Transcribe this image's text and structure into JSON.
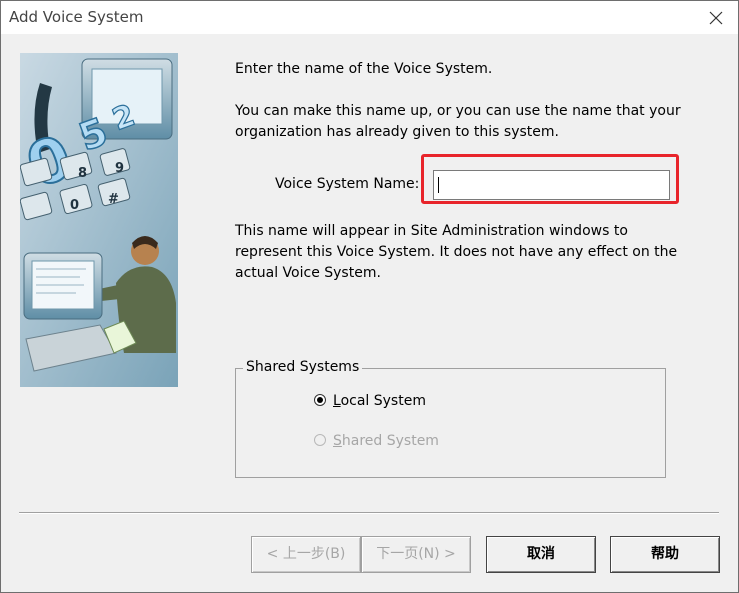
{
  "window": {
    "title": "Add Voice System"
  },
  "content": {
    "intro": "Enter the name of the Voice System.",
    "explanation": [
      "You can make this name up, or you can use the name that your",
      "organization has already given to this system."
    ],
    "name_label": "Voice System Name:",
    "name_value": "",
    "note": [
      "This name will appear in Site Administration windows to",
      "represent this Voice System.  It does not have any effect on the",
      "actual Voice System."
    ]
  },
  "shared_systems": {
    "legend": "Shared Systems",
    "options": [
      {
        "label_hotkey": "L",
        "label_rest": "ocal System",
        "selected": true,
        "enabled": true
      },
      {
        "label_hotkey": "S",
        "label_rest": "hared System",
        "selected": false,
        "enabled": false
      }
    ]
  },
  "buttons": {
    "back": "< 上一步(B)",
    "next": "下一页(N) >",
    "cancel": "取消",
    "help": "帮助"
  },
  "colors": {
    "highlight": "#e8242b",
    "dialog_bg": "#f0f0f0",
    "disabled_text": "#a6a6a6"
  },
  "icons": {
    "close": "close-icon",
    "illustration": "voice-system-wizard-illustration"
  }
}
